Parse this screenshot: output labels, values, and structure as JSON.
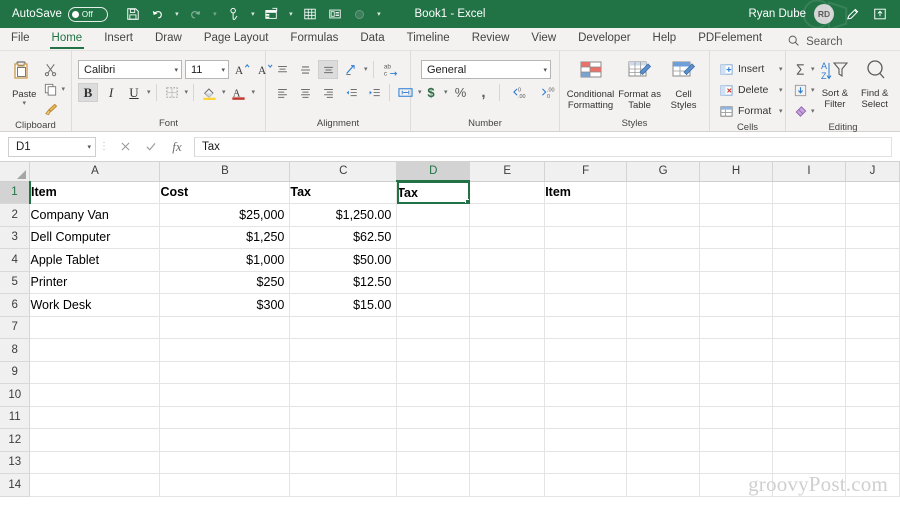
{
  "titlebar": {
    "autosave_label": "AutoSave",
    "autosave_state": "Off",
    "document_title": "Book1  -  Excel",
    "user_name": "Ryan Dube",
    "user_initials": "RD",
    "accent_color": "#217346",
    "qat": [
      {
        "name": "save-icon",
        "label": "Save"
      },
      {
        "name": "undo-icon",
        "label": "Undo"
      },
      {
        "name": "redo-icon",
        "label": "Redo"
      },
      {
        "name": "touch-mode-icon",
        "label": "Touch/Mouse Mode"
      },
      {
        "name": "pivot-table-icon",
        "label": "PivotTable"
      },
      {
        "name": "table-icon",
        "label": "Table"
      },
      {
        "name": "form-icon",
        "label": "Form"
      },
      {
        "name": "record-macro-icon",
        "label": "Record Macro"
      },
      {
        "name": "customize-qat-icon",
        "label": "Customize Quick Access Toolbar"
      }
    ],
    "ribbon_display_icon": "ribbon-display-options-icon",
    "pen_icon": "pen-icon"
  },
  "tabs": [
    {
      "label": "File",
      "active": false
    },
    {
      "label": "Home",
      "active": true
    },
    {
      "label": "Insert",
      "active": false
    },
    {
      "label": "Draw",
      "active": false
    },
    {
      "label": "Page Layout",
      "active": false
    },
    {
      "label": "Formulas",
      "active": false
    },
    {
      "label": "Data",
      "active": false
    },
    {
      "label": "Timeline",
      "active": false
    },
    {
      "label": "Review",
      "active": false
    },
    {
      "label": "View",
      "active": false
    },
    {
      "label": "Developer",
      "active": false
    },
    {
      "label": "Help",
      "active": false
    },
    {
      "label": "PDFelement",
      "active": false
    }
  ],
  "search": {
    "label": "Search",
    "icon": "search-icon"
  },
  "ribbon": {
    "clipboard": {
      "group_label": "Clipboard",
      "paste_label": "Paste",
      "cut_label": "Cut",
      "copy_label": "Copy",
      "format_painter_label": "Format Painter",
      "launcher": "dialog-launcher"
    },
    "font": {
      "group_label": "Font",
      "font_name": "Calibri",
      "font_size": "11",
      "grow_font_label": "A",
      "shrink_font_label": "A",
      "bold_label": "B",
      "italic_label": "I",
      "underline_label": "U",
      "borders_label": "Borders",
      "fill_color_label": "Fill Color",
      "font_color_label": "A",
      "launcher": "dialog-launcher"
    },
    "alignment": {
      "group_label": "Alignment",
      "orientation_label": "Orientation",
      "wrap_text_label": "Wrap Text",
      "merge_label": "Merge & Center",
      "launcher": "dialog-launcher"
    },
    "number": {
      "group_label": "Number",
      "format_value": "General",
      "currency_label": "$",
      "percent_label": "%",
      "comma_label": ",",
      "increase_decimal_label": "Increase Decimal",
      "decrease_decimal_label": "Decrease Decimal",
      "launcher": "dialog-launcher"
    },
    "styles": {
      "group_label": "Styles",
      "conditional_formatting": "Conditional\nFormatting",
      "conditional_formatting_line1": "Conditional",
      "conditional_formatting_line2": "Formatting",
      "format_as_table_line1": "Format as",
      "format_as_table_line2": "Table",
      "cell_styles_line1": "Cell",
      "cell_styles_line2": "Styles"
    },
    "cells": {
      "group_label": "Cells",
      "insert_label": "Insert",
      "delete_label": "Delete",
      "format_label": "Format"
    },
    "editing": {
      "group_label": "Editing",
      "autosum_label": "AutoSum",
      "fill_label": "Fill",
      "clear_label": "Clear",
      "sort_filter_line1": "Sort &",
      "sort_filter_line2": "Filter",
      "find_select_line1": "Find &",
      "find_select_line2": "Select"
    }
  },
  "formula_bar": {
    "name_box_value": "D1",
    "cancel_icon": "close-icon",
    "confirm_icon": "check-icon",
    "function_icon": "fx-icon",
    "formula_value": "Tax"
  },
  "grid": {
    "columns": [
      "A",
      "B",
      "C",
      "D",
      "E",
      "F",
      "G",
      "H",
      "I",
      "J"
    ],
    "selected_column": "D",
    "selected_row": 1,
    "selected_cell": "D1",
    "rows": [
      {
        "n": "1",
        "cells": [
          "Item",
          "Cost",
          "Tax",
          "Tax",
          "",
          "Item",
          "",
          "",
          "",
          ""
        ]
      },
      {
        "n": "2",
        "cells": [
          "Company Van",
          "$25,000",
          "$1,250.00",
          "",
          "",
          "",
          "",
          "",
          "",
          ""
        ]
      },
      {
        "n": "3",
        "cells": [
          "Dell Computer",
          "$1,250",
          "$62.50",
          "",
          "",
          "",
          "",
          "",
          "",
          ""
        ]
      },
      {
        "n": "4",
        "cells": [
          "Apple Tablet",
          "$1,000",
          "$50.00",
          "",
          "",
          "",
          "",
          "",
          "",
          ""
        ]
      },
      {
        "n": "5",
        "cells": [
          "Printer",
          "$250",
          "$12.50",
          "",
          "",
          "",
          "",
          "",
          "",
          ""
        ]
      },
      {
        "n": "6",
        "cells": [
          "Work Desk",
          "$300",
          "$15.00",
          "",
          "",
          "",
          "",
          "",
          "",
          ""
        ]
      },
      {
        "n": "7",
        "cells": [
          "",
          "",
          "",
          "",
          "",
          "",
          "",
          "",
          "",
          ""
        ]
      },
      {
        "n": "8",
        "cells": [
          "",
          "",
          "",
          "",
          "",
          "",
          "",
          "",
          "",
          ""
        ]
      },
      {
        "n": "9",
        "cells": [
          "",
          "",
          "",
          "",
          "",
          "",
          "",
          "",
          "",
          ""
        ]
      },
      {
        "n": "10",
        "cells": [
          "",
          "",
          "",
          "",
          "",
          "",
          "",
          "",
          "",
          ""
        ]
      },
      {
        "n": "11",
        "cells": [
          "",
          "",
          "",
          "",
          "",
          "",
          "",
          "",
          "",
          ""
        ]
      },
      {
        "n": "12",
        "cells": [
          "",
          "",
          "",
          "",
          "",
          "",
          "",
          "",
          "",
          ""
        ]
      },
      {
        "n": "13",
        "cells": [
          "",
          "",
          "",
          "",
          "",
          "",
          "",
          "",
          "",
          ""
        ]
      },
      {
        "n": "14",
        "cells": [
          "",
          "",
          "",
          "",
          "",
          "",
          "",
          "",
          "",
          ""
        ]
      }
    ]
  },
  "watermark": {
    "text": "groovyPost.com"
  }
}
